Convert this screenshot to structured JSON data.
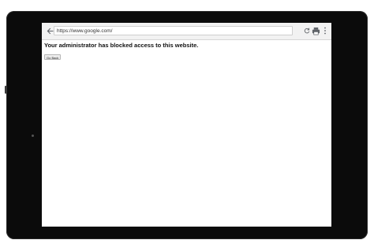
{
  "browser": {
    "url": "https://www.google.com/",
    "back_icon": "arrow-left-icon",
    "reload_icon": "reload-icon",
    "print_icon": "print-icon",
    "menu_icon": "kebab-menu-icon"
  },
  "page": {
    "heading": "Your administrator has blocked access to this website.",
    "go_back_label": "Go Back"
  },
  "colors": {
    "device_frame": "#0b0b0b",
    "toolbar": "#f2f2f2",
    "page_background": "#ffffff"
  }
}
